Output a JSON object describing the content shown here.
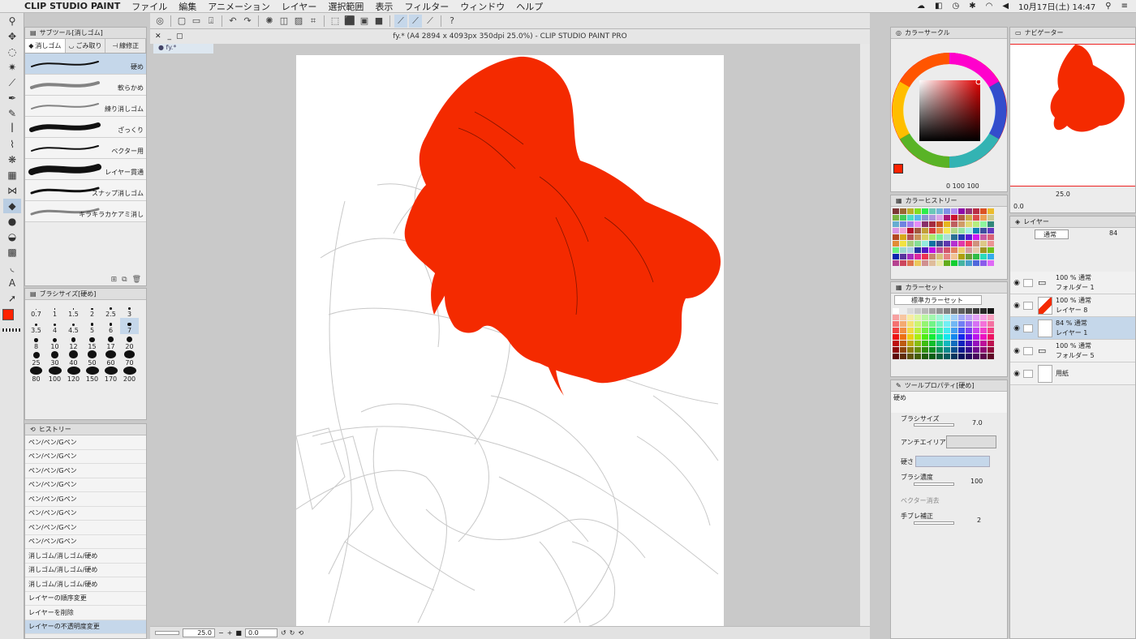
{
  "menubar": {
    "app_name": "CLIP STUDIO PAINT",
    "items": [
      "ファイル",
      "編集",
      "アニメーション",
      "レイヤー",
      "選択範囲",
      "表示",
      "フィルター",
      "ウィンドウ",
      "ヘルプ"
    ],
    "clock": "10月17日(土)  14:47"
  },
  "document": {
    "title": "fy.* (A4 2894 x 4093px 350dpi 25.0%)  - CLIP STUDIO PAINT PRO",
    "tab": "fy.*",
    "zoom": "25.0",
    "angle": "0.0"
  },
  "subtool": {
    "header": "サブツール[消しゴム]",
    "tabs": [
      "消しゴム",
      "ごみ取り",
      "線修正"
    ],
    "brushes": [
      {
        "label": "硬め",
        "selected": true
      },
      {
        "label": "軟らかめ",
        "selected": false
      },
      {
        "label": "練り消しゴム",
        "selected": false
      },
      {
        "label": "ざっくり",
        "selected": false
      },
      {
        "label": "ベクター用",
        "selected": false
      },
      {
        "label": "レイヤー貫通",
        "selected": false
      },
      {
        "label": "スナップ消しゴム",
        "selected": false
      },
      {
        "label": "キラキラカケアミ消し",
        "selected": false
      }
    ]
  },
  "brushsize": {
    "header": "ブラシサイズ[硬め]",
    "sizes": [
      "0.7",
      "1",
      "1.5",
      "2",
      "2.5",
      "3",
      "3.5",
      "4",
      "4.5",
      "5",
      "6",
      "7",
      "8",
      "10",
      "12",
      "15",
      "17",
      "20",
      "25",
      "30",
      "40",
      "50",
      "60",
      "70",
      "80",
      "100",
      "120",
      "150",
      "170",
      "200"
    ],
    "selected": "7"
  },
  "history": {
    "header": "ヒストリー",
    "items": [
      "ペン/ペン/Gペン",
      "ペン/ペン/Gペン",
      "ペン/ペン/Gペン",
      "ペン/ペン/Gペン",
      "ペン/ペン/Gペン",
      "ペン/ペン/Gペン",
      "ペン/ペン/Gペン",
      "ペン/ペン/Gペン",
      "消しゴム/消しゴム/硬め",
      "消しゴム/消しゴム/硬め",
      "消しゴム/消しゴム/硬め",
      "レイヤーの順序変更",
      "レイヤーを削除",
      "レイヤーの不透明度変更"
    ]
  },
  "colorcircle": {
    "header": "カラーサークル",
    "main_color": "#ff2200",
    "values": "0  100  100"
  },
  "colorhistory": {
    "header": "カラーヒストリー"
  },
  "colorset": {
    "header": "カラーセット",
    "selected": "標準カラーセット"
  },
  "toolprops": {
    "header": "ツールプロパティ[硬め]",
    "name": "硬め",
    "brush_size_label": "ブラシサイズ",
    "brush_size": "7.0",
    "antialias_label": "アンチエイリアス",
    "hardness_label": "硬さ",
    "density_label": "ブラシ濃度",
    "density": "100",
    "vector_label": "ベクター消去",
    "stabilizer_label": "手ブレ補正",
    "stabilizer": "2"
  },
  "navigator": {
    "header": "ナビゲーター",
    "zoom": "25.0",
    "angle": "0.0"
  },
  "layers": {
    "header": "レイヤー",
    "blend": "通常",
    "opacity": "84",
    "items": [
      {
        "line1": "100 % 通常",
        "line2": "フォルダー 1",
        "type": "folder",
        "selected": false
      },
      {
        "line1": "100 % 通常",
        "line2": "レイヤー 8",
        "type": "layer-red",
        "selected": false
      },
      {
        "line1": "84 % 通常",
        "line2": "レイヤー 1",
        "type": "layer",
        "selected": true
      },
      {
        "line1": "100 % 通常",
        "line2": "フォルダー 5",
        "type": "folder",
        "selected": false
      },
      {
        "line1": "",
        "line2": "用紙",
        "type": "paper",
        "selected": false
      }
    ]
  },
  "colors": {
    "accent": "#c5d7ea",
    "hair": "#f42a00"
  }
}
